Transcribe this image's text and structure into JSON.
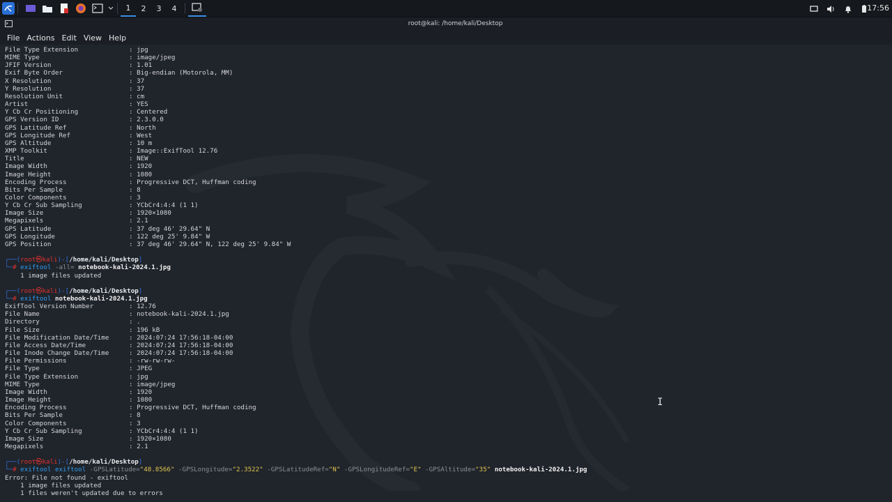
{
  "panel": {
    "workspaces": [
      "1",
      "2",
      "3",
      "4"
    ],
    "active_workspace": "1",
    "clock": "17:56",
    "icons": [
      "kali-menu-icon",
      "workspace-icon",
      "file-manager-icon",
      "text-editor-icon",
      "firefox-icon",
      "terminal-icon",
      "chevron-down-icon",
      "screenshot-icon",
      "window-icon",
      "volume-icon",
      "notification-icon",
      "battery-icon"
    ]
  },
  "window": {
    "title": "root@kali: /home/kali/Desktop",
    "menu": [
      "File",
      "Actions",
      "Edit",
      "View",
      "Help"
    ]
  },
  "terminal": {
    "block1": [
      [
        "File Type Extension",
        "jpg"
      ],
      [
        "MIME Type",
        "image/jpeg"
      ],
      [
        "JFIF Version",
        "1.01"
      ],
      [
        "Exif Byte Order",
        "Big-endian (Motorola, MM)"
      ],
      [
        "X Resolution",
        "37"
      ],
      [
        "Y Resolution",
        "37"
      ],
      [
        "Resolution Unit",
        "cm"
      ],
      [
        "Artist",
        "YES"
      ],
      [
        "Y Cb Cr Positioning",
        "Centered"
      ],
      [
        "GPS Version ID",
        "2.3.0.0"
      ],
      [
        "GPS Latitude Ref",
        "North"
      ],
      [
        "GPS Longitude Ref",
        "West"
      ],
      [
        "GPS Altitude",
        "10 m"
      ],
      [
        "XMP Toolkit",
        "Image::ExifTool 12.76"
      ],
      [
        "Title",
        "NEW"
      ],
      [
        "Image Width",
        "1920"
      ],
      [
        "Image Height",
        "1080"
      ],
      [
        "Encoding Process",
        "Progressive DCT, Huffman coding"
      ],
      [
        "Bits Per Sample",
        "8"
      ],
      [
        "Color Components",
        "3"
      ],
      [
        "Y Cb Cr Sub Sampling",
        "YCbCr4:4:4 (1 1)"
      ],
      [
        "Image Size",
        "1920×1080"
      ],
      [
        "Megapixels",
        "2.1"
      ],
      [
        "GPS Latitude",
        "37 deg 46' 29.64\" N"
      ],
      [
        "GPS Longitude",
        "122 deg 25' 9.84\" W"
      ],
      [
        "GPS Position",
        "37 deg 46' 29.64\" N, 122 deg 25' 9.84\" W"
      ]
    ],
    "prompt": {
      "top_left": "┌──(",
      "user": "root㉿kali",
      "mid": ")-[",
      "path": "/home/kali/Desktop",
      "end": "]",
      "bottom_left": "└─",
      "symbol": "#"
    },
    "cmd1": {
      "tool": "exiftool",
      "args": "-all=",
      "file": "notebook-kali-2024.1.jpg",
      "output": "    1 image files updated"
    },
    "cmd2": {
      "tool": "exiftool",
      "file": "notebook-kali-2024.1.jpg"
    },
    "block2": [
      [
        "ExifTool Version Number",
        "12.76"
      ],
      [
        "File Name",
        "notebook-kali-2024.1.jpg"
      ],
      [
        "Directory",
        "."
      ],
      [
        "File Size",
        "196 kB"
      ],
      [
        "File Modification Date/Time",
        "2024:07:24 17:56:18-04:00"
      ],
      [
        "File Access Date/Time",
        "2024:07:24 17:56:18-04:00"
      ],
      [
        "File Inode Change Date/Time",
        "2024:07:24 17:56:18-04:00"
      ],
      [
        "File Permissions",
        "-rw-rw-rw-"
      ],
      [
        "File Type",
        "JPEG"
      ],
      [
        "File Type Extension",
        "jpg"
      ],
      [
        "MIME Type",
        "image/jpeg"
      ],
      [
        "Image Width",
        "1920"
      ],
      [
        "Image Height",
        "1080"
      ],
      [
        "Encoding Process",
        "Progressive DCT, Huffman coding"
      ],
      [
        "Bits Per Sample",
        "8"
      ],
      [
        "Color Components",
        "3"
      ],
      [
        "Y Cb Cr Sub Sampling",
        "YCbCr4:4:4 (1 1)"
      ],
      [
        "Image Size",
        "1920×1080"
      ],
      [
        "Megapixels",
        "2.1"
      ]
    ],
    "cmd3": {
      "tool": "exiftool",
      "arg0": "exiftool",
      "parts": [
        {
          "k": "-GPSLatitude=",
          "v": "\"48.8566\""
        },
        {
          "k": "-GPSLongitude=",
          "v": "\"2.3522\""
        },
        {
          "k": "-GPSLatitudeRef=",
          "v": "\"N\""
        },
        {
          "k": "-GPSLongitudeRef=",
          "v": "\"E\""
        },
        {
          "k": "-GPSAltitude=",
          "v": "\"35\""
        }
      ],
      "file": "notebook-kali-2024.1.jpg",
      "output": [
        "Error: File not found - exiftool",
        "    1 image files updated",
        "    1 files weren't updated due to errors"
      ]
    }
  },
  "colors": {
    "accent": "#2d9bf0",
    "prompt_user": "#e0322e",
    "string": "#e0c650",
    "background": "#20242b"
  }
}
